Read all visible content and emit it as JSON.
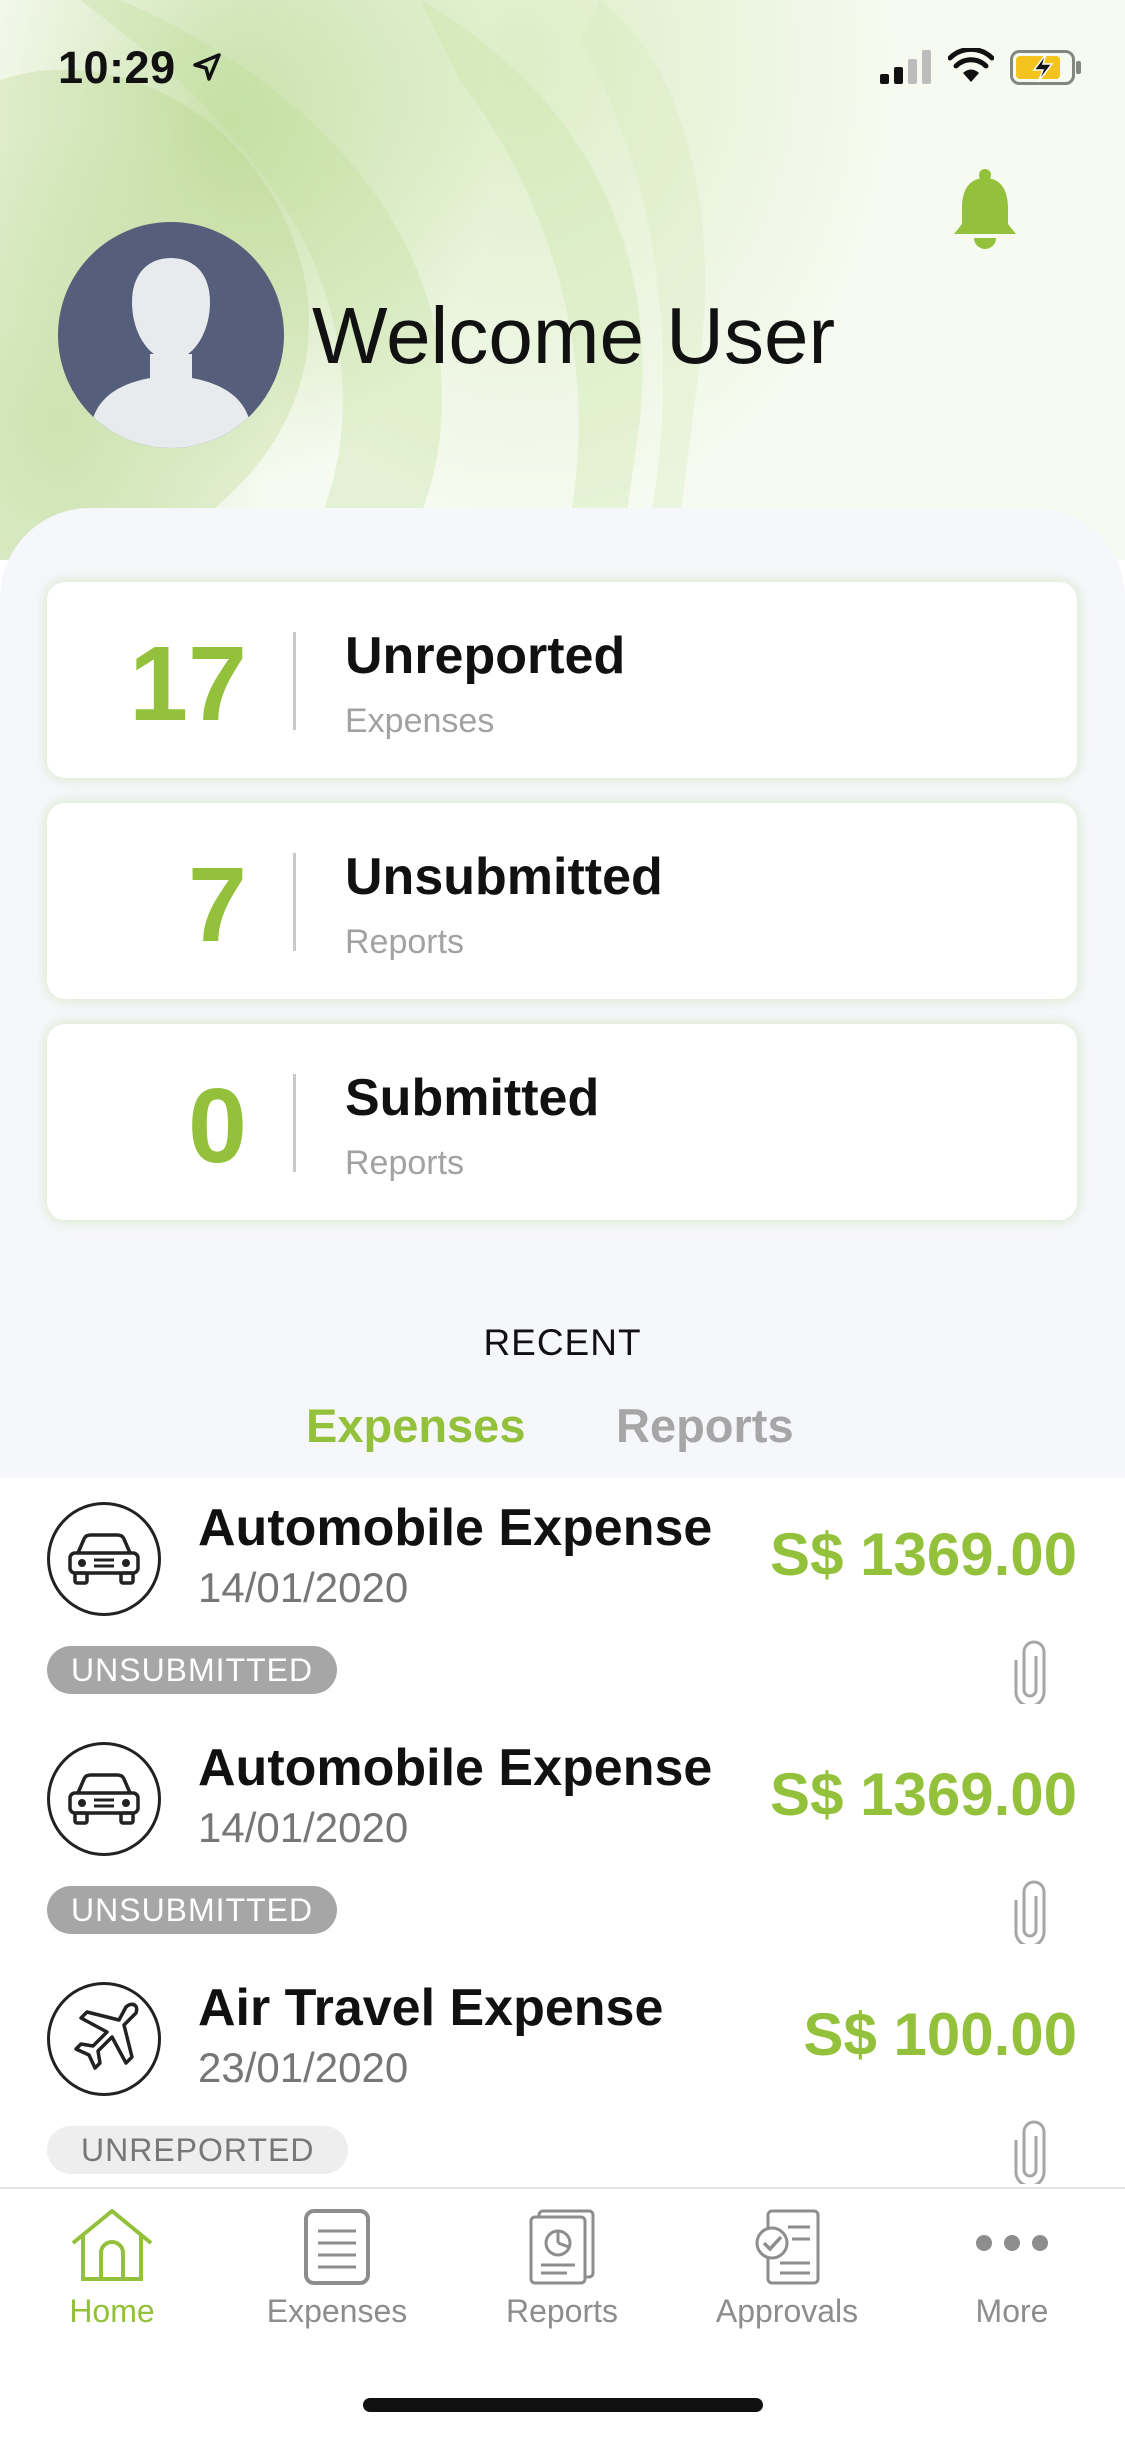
{
  "status_bar": {
    "time": "10:29"
  },
  "header": {
    "welcome": "Welcome User"
  },
  "summary_cards": [
    {
      "count": "17",
      "title": "Unreported",
      "subtitle": "Expenses"
    },
    {
      "count": "7",
      "title": "Unsubmitted",
      "subtitle": "Reports"
    },
    {
      "count": "0",
      "title": "Submitted",
      "subtitle": "Reports"
    }
  ],
  "recent": {
    "heading": "RECENT",
    "tabs": [
      {
        "label": "Expenses",
        "active": true
      },
      {
        "label": "Reports",
        "active": false
      }
    ]
  },
  "expenses": [
    {
      "title": "Automobile Expense",
      "date": "14/01/2020",
      "amount": "S$ 1369.00",
      "status": "UNSUBMITTED",
      "icon": "car-icon"
    },
    {
      "title": "Automobile Expense",
      "date": "14/01/2020",
      "amount": "S$ 1369.00",
      "status": "UNSUBMITTED",
      "icon": "car-icon"
    },
    {
      "title": "Air Travel Expense",
      "date": "23/01/2020",
      "amount": "S$ 100.00",
      "status": "UNREPORTED",
      "icon": "airplane-icon"
    }
  ],
  "tab_bar": [
    {
      "label": "Home",
      "icon": "home-icon",
      "active": true
    },
    {
      "label": "Expenses",
      "icon": "expenses-icon",
      "active": false
    },
    {
      "label": "Reports",
      "icon": "reports-icon",
      "active": false
    },
    {
      "label": "Approvals",
      "icon": "approvals-icon",
      "active": false
    },
    {
      "label": "More",
      "icon": "more-icon",
      "active": false
    }
  ],
  "colors": {
    "accent": "#93c13b",
    "muted": "#a6a6a6",
    "avatar": "#555e7b"
  }
}
